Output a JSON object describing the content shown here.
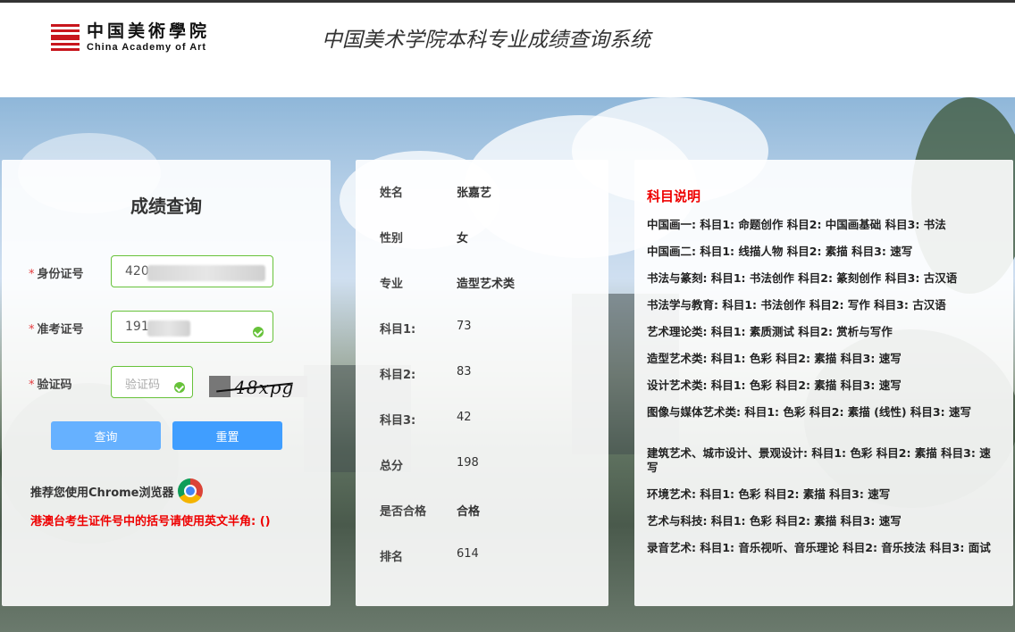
{
  "header": {
    "logo_cn": "中国美術學院",
    "logo_en": "China Academy of Art",
    "site_title": "中国美术学院本科专业成绩查询系统"
  },
  "colors": {
    "accent": "#409eff",
    "valid": "#67c23a",
    "warning": "#e00000",
    "brand": "#c8161d"
  },
  "query": {
    "title": "成绩查询",
    "id_label": "身份证号",
    "id_value": "420",
    "exam_label": "准考证号",
    "exam_value": "191",
    "captcha_label": "验证码",
    "captcha_placeholder": "验证码",
    "captcha_image_text": "48xpg",
    "query_button": "查询",
    "reset_button": "重置",
    "chrome_tip": "推荐您使用Chrome浏览器",
    "hk_tip": "港澳台考生证件号中的括号请使用英文半角: ()"
  },
  "result": {
    "rows": [
      {
        "label": "姓名",
        "value": "张嘉艺"
      },
      {
        "label": "性别",
        "value": "女"
      },
      {
        "label": "专业",
        "value": "造型艺术类"
      },
      {
        "label": "科目1:",
        "value": "73"
      },
      {
        "label": "科目2:",
        "value": "83"
      },
      {
        "label": "科目3:",
        "value": "42"
      },
      {
        "label": "总分",
        "value": "198"
      },
      {
        "label": "是否合格",
        "value": "合格"
      },
      {
        "label": "排名",
        "value": "614"
      }
    ]
  },
  "explain": {
    "title": "科目说明",
    "items": [
      "中国画一: 科目1: 命题创作 科目2: 中国画基础 科目3: 书法",
      "中国画二: 科目1: 线描人物 科目2: 素描 科目3: 速写",
      "书法与篆刻: 科目1: 书法创作 科目2: 篆刻创作 科目3: 古汉语",
      "书法学与教育: 科目1: 书法创作 科目2: 写作 科目3: 古汉语",
      "艺术理论类: 科目1: 素质测试 科目2: 赏析与写作",
      "造型艺术类: 科目1: 色彩 科目2: 素描 科目3: 速写",
      "设计艺术类: 科目1: 色彩 科目2: 素描 科目3: 速写",
      "图像与媒体艺术类: 科目1: 色彩 科目2: 素描 (线性) 科目3: 速写",
      "建筑艺术、城市设计、景观设计: 科目1: 色彩 科目2: 素描 科目3: 速写",
      "环境艺术: 科目1: 色彩 科目2: 素描 科目3: 速写",
      "艺术与科技: 科目1: 色彩 科目2: 素描 科目3: 速写",
      "录音艺术: 科目1: 音乐视听、音乐理论 科目2: 音乐技法 科目3: 面试"
    ]
  }
}
